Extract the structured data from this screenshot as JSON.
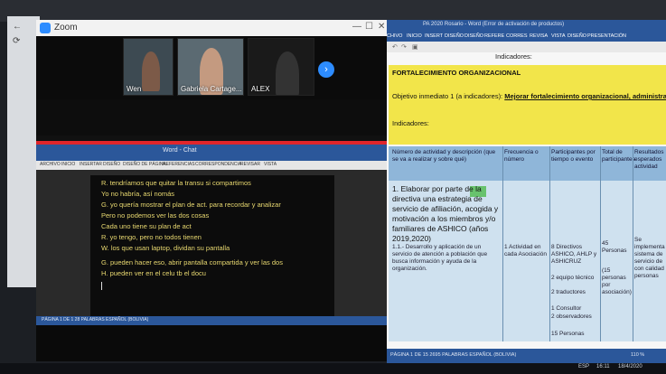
{
  "zoom": {
    "window_title": "Zoom",
    "participants": [
      {
        "name": "Wen"
      },
      {
        "name": "Gabriela Cartage..."
      },
      {
        "name": "ALEX"
      }
    ],
    "next_page_icon": "chevron-right-icon"
  },
  "shared_word": {
    "title_bar": "Word - Chat",
    "tabs": [
      "ARCHIVO",
      "INICIO",
      "INSERTAR",
      "DISEÑO",
      "DISEÑO DE PÁGINA",
      "REFERENCIAS",
      "CORRESPONDENCIA",
      "REVISAR",
      "VISTA"
    ],
    "chat_lines": [
      "R. tendríamos que quitar la transu si compartimos",
      "Yo no habría, así nomás",
      "G. yo quería mostrar el plan de act. para recordar y analizar",
      "Pero no podemos ver las dos cosas",
      "Cada uno tiene su plan de act",
      "R. yo tengo, pero no todos tienen",
      "W. los que usan laptop, dividan su pantalla",
      "G. pueden hacer eso, abrir pantalla compartida y ver las dos",
      "H. pueden ver en el celu tb el docu"
    ],
    "status": "PÁGINA 1 DE 1   28 PALABRAS   ESPAÑOL (BOLIVIA)"
  },
  "document": {
    "title": "PA 2020 Rosario - Word (Error de activación de productos)",
    "menu": [
      "CHIVO",
      "INICIO",
      "INSERT",
      "DISEÑO",
      "DISEÑO",
      "REFERE",
      "CORRES",
      "REVISA",
      "VISTA",
      "DISEÑO",
      "PRESENTACIÓN"
    ],
    "header_label": "Indicadores:",
    "section_title": "FORTALECIMIENTO ORGANIZACIONAL",
    "objective_prefix": "Objetivo inmediato 1 (a indicadores):",
    "objective_text": "Mejorar fortalecimiento organizacional, administrativa y la part",
    "indicators_label": "Indicadores:",
    "table_headers": [
      "Número de actividad y descripción (que se va a realizar y sobre qué)",
      "Frecuencia o número",
      "Participantes por tiempo o evento",
      "Total de participantes",
      "Resultados esperados actividad"
    ],
    "activity_title": "1. Elaborar por parte de la directiva una estrategia de servicio de afiliación, acogida y motivación a los miembros y/o familiares de ASHICO (años 2019,2020)",
    "activity_sub": "1.1.- Desarrollo y aplicación de un servicio de atención a población que busca información y ayuda de la organización.",
    "frequency": "1 Actividad en cada Asociación",
    "participants": [
      "8 Directivos ASHICO, AHLP y ASHICRUZ",
      "2 equipo técnico",
      "2 traductores",
      "1 Consultor",
      "2 observadores",
      "15 Personas"
    ],
    "total": [
      "45 Personas",
      "(15 personas por asociación)"
    ],
    "results": "Se implementa sistema de servicio de con calidad personas",
    "status": "PÁGINA 1 DE 15   2695 PALABRAS   ESPAÑOL (BOLIVIA)",
    "zoom": "110 %"
  },
  "taskbar": {
    "lang": "ESP",
    "time": "16:11",
    "date": "18/4/2020"
  }
}
